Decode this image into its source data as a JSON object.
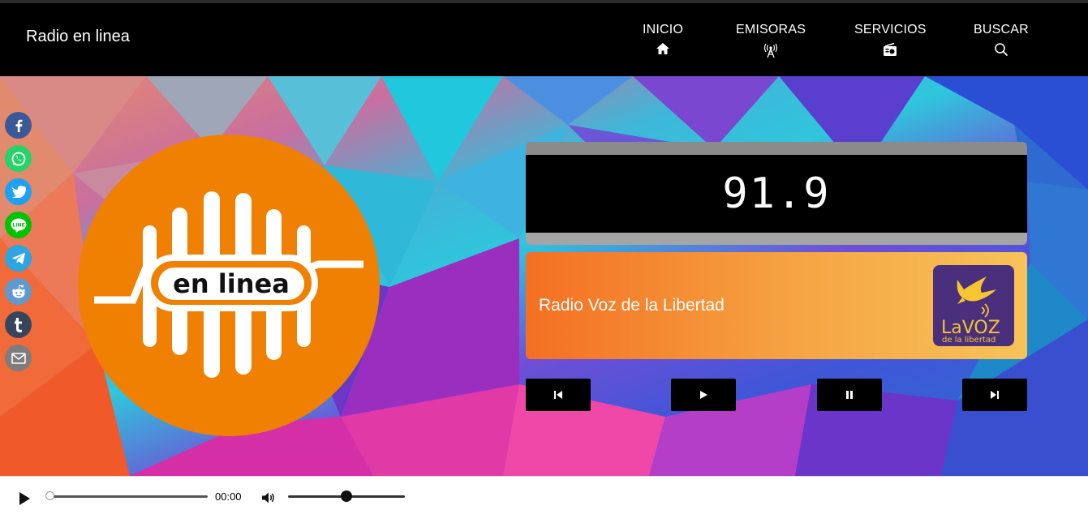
{
  "header": {
    "brand": "Radio en linea",
    "nav": [
      {
        "label": "INICIO",
        "icon": "home-icon"
      },
      {
        "label": "EMISORAS",
        "icon": "antenna-icon"
      },
      {
        "label": "SERVICIOS",
        "icon": "radio-icon"
      },
      {
        "label": "BUSCAR",
        "icon": "search-icon"
      }
    ]
  },
  "share": [
    {
      "icon": "facebook-icon",
      "color": "#3b5998"
    },
    {
      "icon": "whatsapp-icon",
      "color": "#25d366"
    },
    {
      "icon": "twitter-icon",
      "color": "#1da1f2"
    },
    {
      "icon": "line-icon",
      "color": "#00c300"
    },
    {
      "icon": "telegram-icon",
      "color": "#2ca5e0"
    },
    {
      "icon": "reddit-icon",
      "color": "#5f99cf"
    },
    {
      "icon": "tumblr-icon",
      "color": "#35465c"
    },
    {
      "icon": "email-icon",
      "color": "#7d7d7d"
    }
  ],
  "logo": {
    "text": "en linea",
    "color": "#ef8001"
  },
  "station": {
    "frequency": "91.9",
    "name": "Radio Voz de la Libertad",
    "logo_text_main": "LaVOZ",
    "logo_text_sub": "de la libertad"
  },
  "controls": [
    {
      "name": "previous-button",
      "icon": "skip-back-icon"
    },
    {
      "name": "play-button",
      "icon": "play-icon"
    },
    {
      "name": "pause-button",
      "icon": "pause-icon"
    },
    {
      "name": "next-button",
      "icon": "skip-forward-icon"
    }
  ],
  "player": {
    "time": "00:00",
    "progress": 0,
    "volume": 0.5
  }
}
